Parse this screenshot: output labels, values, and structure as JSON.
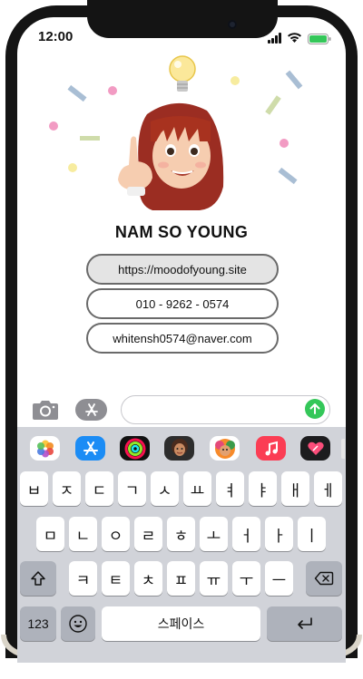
{
  "status_bar": {
    "time": "12:00"
  },
  "profile": {
    "name": "NAM SO YOUNG",
    "website": "https://moodofyoung.site",
    "phone": "010 - 9262 - 0574",
    "email": "whitensh0574@naver.com"
  },
  "message_bar": {
    "input_value": ""
  },
  "app_strip": [
    "photos-app",
    "app-store",
    "fitness-activity",
    "memoji",
    "memoji-stickers",
    "music-app",
    "digital-touch-heart"
  ],
  "keyboard": {
    "row1": [
      "ㅂ",
      "ㅈ",
      "ㄷ",
      "ㄱ",
      "ㅅ",
      "ㅛ",
      "ㅕ",
      "ㅑ",
      "ㅐ",
      "ㅔ"
    ],
    "row2": [
      "ㅁ",
      "ㄴ",
      "ㅇ",
      "ㄹ",
      "ㅎ",
      "ㅗ",
      "ㅓ",
      "ㅏ",
      "ㅣ"
    ],
    "row3": [
      "ㅋ",
      "ㅌ",
      "ㅊ",
      "ㅍ",
      "ㅠ",
      "ㅜ",
      "ㅡ"
    ],
    "numbers_label": "123",
    "space_label": "스페이스"
  },
  "colors": {
    "accent_green": "#34c759",
    "keyboard_bg": "#d1d3d9",
    "phone_frame": "#141414"
  }
}
